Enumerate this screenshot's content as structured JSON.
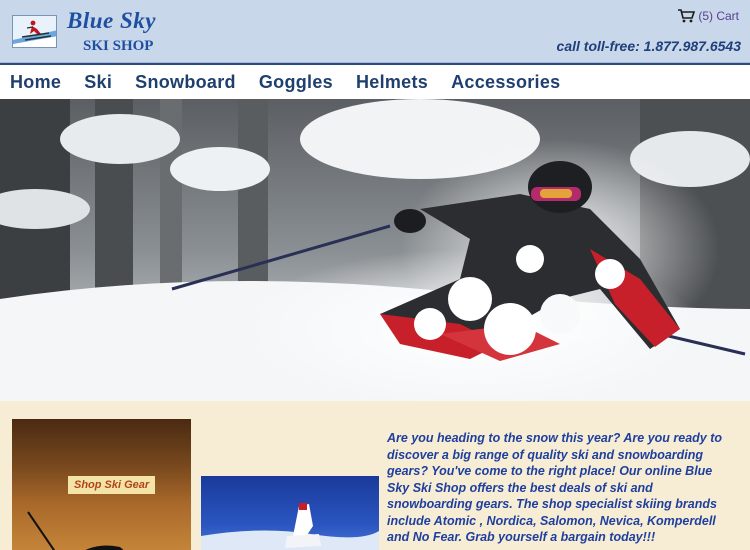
{
  "header": {
    "brand_title": "Blue Sky",
    "brand_subtitle": "SKI SHOP",
    "cart_label": "(5) Cart",
    "phone": "call toll-free: 1.877.987.6543"
  },
  "nav": {
    "items": [
      "Home",
      "Ski",
      "Snowboard",
      "Goggles",
      "Helmets",
      "Accessories"
    ]
  },
  "promo": {
    "shop_gear_label": "Shop Ski Gear"
  },
  "intro": {
    "lines": [
      "Are you heading to the snow this year? Are you ready to",
      "discover a big range of quality ski and snowboarding",
      "gears? You've come to the right place! Our online Blue",
      "Sky Ski Shop offers the best deals of ski and",
      "snowboarding gears. The shop specialist skiing brands",
      "include Atomic , Nordica, Salomon, Nevica, Komperdell",
      "and No Fear. Grab yourself a bargain today!!!"
    ]
  },
  "colors": {
    "header_bg": "#c9d7ea",
    "brand": "#1f4fa0",
    "nav_text": "#1f3f6f",
    "content_bg": "#f6edd4",
    "intro_text": "#1f3f9f"
  },
  "icons": {
    "cart": "shopping-cart-icon",
    "logo": "skier-logo-icon"
  }
}
